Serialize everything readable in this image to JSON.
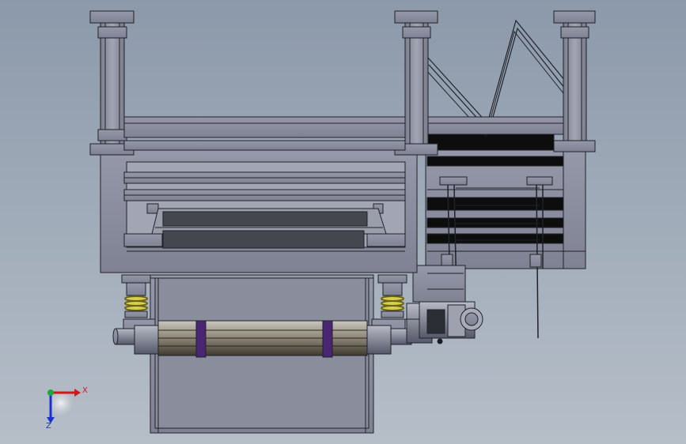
{
  "viewport": {
    "name": "cad-graphics-area",
    "background_top": "#8c99aa",
    "background_bottom": "#b6bec8"
  },
  "model": {
    "part_color": "#8b8e9e",
    "dark_panel_color": "#45474f",
    "slot_color": "#0d0d0d",
    "spring_color": "#d8d048",
    "band_color": "#4a2573",
    "edge_color": "#20222a"
  },
  "triad": {
    "x_label": "X",
    "z_label": "Z",
    "x_color": "#d01818",
    "y_color": "#1fa83a",
    "z_color": "#1c2fd0"
  }
}
